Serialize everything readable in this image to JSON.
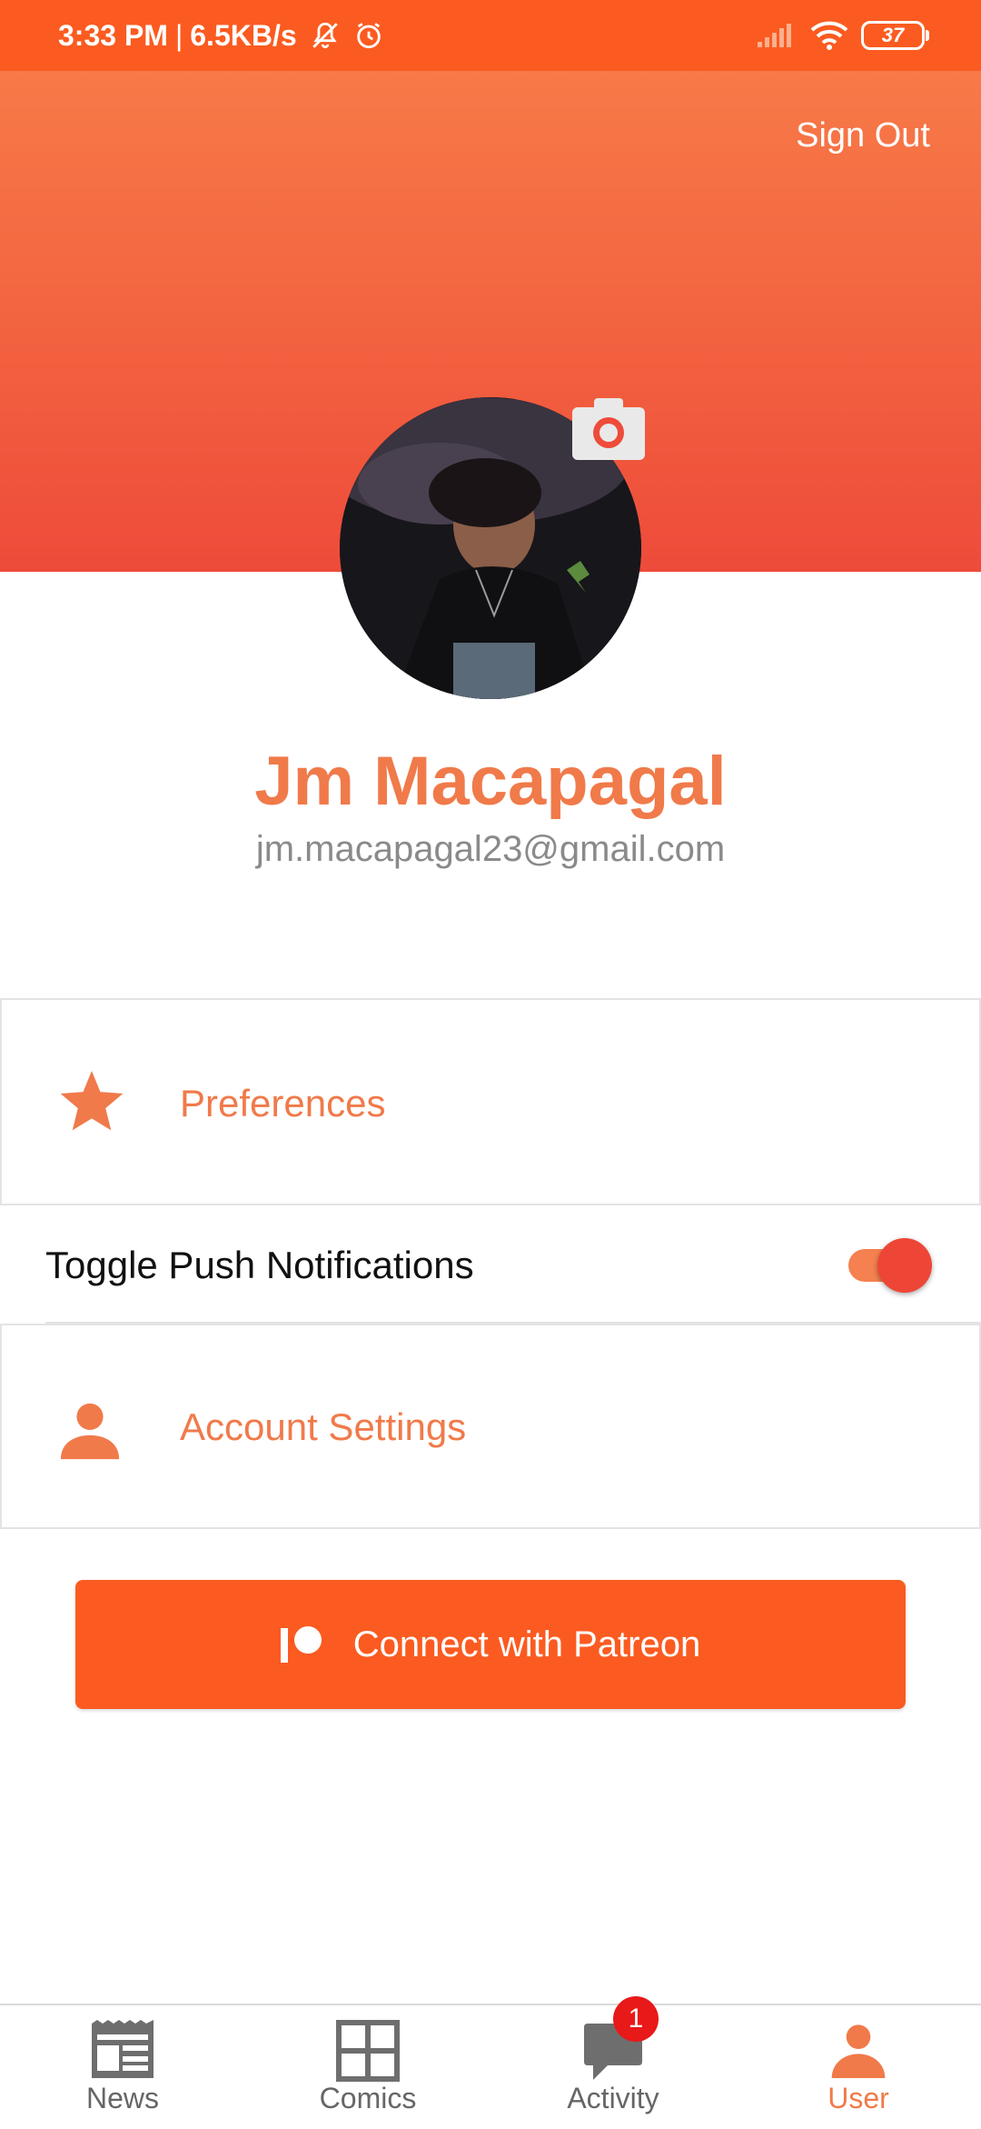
{
  "status_bar": {
    "time": "3:33 PM",
    "separator": "|",
    "speed": "6.5KB/s",
    "battery": "37",
    "icons": [
      "bell-off-icon",
      "alarm-icon",
      "signal-icon",
      "wifi-icon",
      "battery-icon"
    ]
  },
  "header": {
    "sign_out": "Sign Out"
  },
  "profile": {
    "name": "Jm Macapagal",
    "email": "jm.macapagal23@gmail.com"
  },
  "menu": {
    "preferences": "Preferences",
    "toggle_push": "Toggle Push Notifications",
    "toggle_push_on": true,
    "account_settings": "Account Settings"
  },
  "patreon": {
    "label": "Connect with Patreon"
  },
  "nav": {
    "items": [
      {
        "label": "News",
        "icon": "newspaper-icon"
      },
      {
        "label": "Comics",
        "icon": "grid-icon"
      },
      {
        "label": "Activity",
        "icon": "chat-icon"
      },
      {
        "label": "User",
        "icon": "user-icon"
      }
    ],
    "active": "User",
    "activity_badge": "1"
  },
  "colors": {
    "accent": "#fb5b20",
    "accent_text": "#f07a4a",
    "badge": "#e81919",
    "inactive_nav": "#666666"
  }
}
